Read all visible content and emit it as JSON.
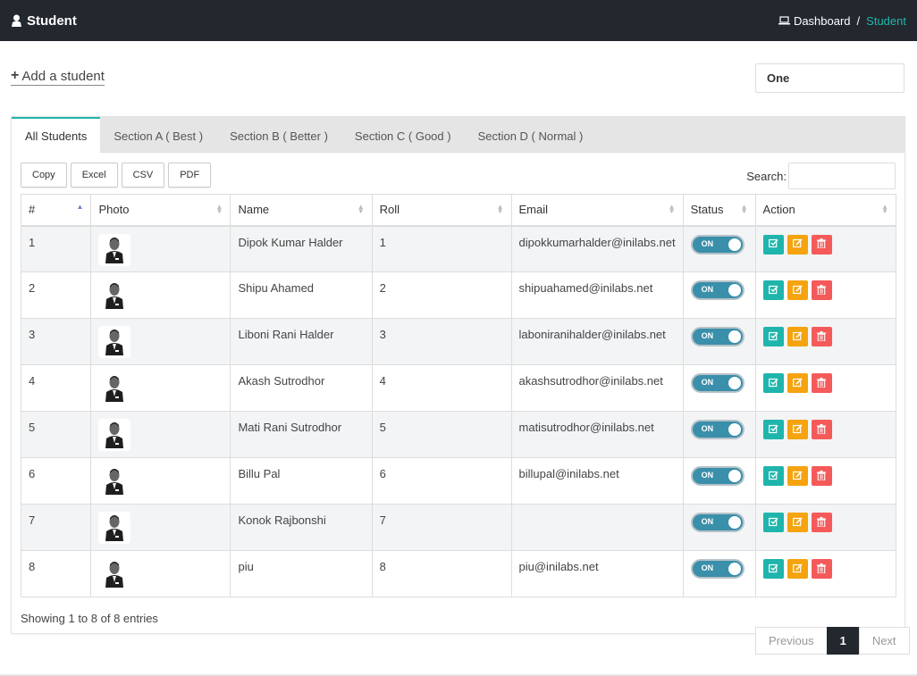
{
  "header": {
    "title": "Student",
    "breadcrumb_home": "Dashboard",
    "breadcrumb_sep": "/",
    "breadcrumb_current": "Student"
  },
  "add_link": {
    "icon": "plus-icon",
    "label": "Add a student"
  },
  "class_select": {
    "value": "One"
  },
  "tabs": [
    {
      "label": "All Students"
    },
    {
      "label": "Section A ( Best )"
    },
    {
      "label": "Section B ( Better )"
    },
    {
      "label": "Section C ( Good )"
    },
    {
      "label": "Section D ( Normal )"
    }
  ],
  "export_buttons": [
    {
      "label": "Copy"
    },
    {
      "label": "Excel"
    },
    {
      "label": "CSV"
    },
    {
      "label": "PDF"
    }
  ],
  "search": {
    "label": "Search:",
    "value": ""
  },
  "table": {
    "columns": [
      "#",
      "Photo",
      "Name",
      "Roll",
      "Email",
      "Status",
      "Action"
    ],
    "rows": [
      {
        "num": "1",
        "name": "Dipok Kumar Halder",
        "roll": "1",
        "email": "dipokkumarhalder@inilabs.net",
        "status": "ON"
      },
      {
        "num": "2",
        "name": "Shipu Ahamed",
        "roll": "2",
        "email": "shipuahamed@inilabs.net",
        "status": "ON"
      },
      {
        "num": "3",
        "name": "Liboni Rani Halder",
        "roll": "3",
        "email": "laboniranihalder@inilabs.net",
        "status": "ON"
      },
      {
        "num": "4",
        "name": "Akash Sutrodhor",
        "roll": "4",
        "email": "akashsutrodhor@inilabs.net",
        "status": "ON"
      },
      {
        "num": "5",
        "name": "Mati Rani Sutrodhor",
        "roll": "5",
        "email": "matisutrodhor@inilabs.net",
        "status": "ON"
      },
      {
        "num": "6",
        "name": "Billu Pal",
        "roll": "6",
        "email": "billupal@inilabs.net",
        "status": "ON"
      },
      {
        "num": "7",
        "name": "Konok Rajbonshi",
        "roll": "7",
        "email": "",
        "status": "ON"
      },
      {
        "num": "8",
        "name": "piu",
        "roll": "8",
        "email": "piu@inilabs.net",
        "status": "ON"
      }
    ]
  },
  "info": "Showing 1 to 8 of 8 entries",
  "pagination": {
    "previous": "Previous",
    "current": "1",
    "next": "Next"
  },
  "colors": {
    "topbar": "#23282f",
    "accent": "#1fb5ac",
    "view": "#1fb5ac",
    "edit": "#f5a30f",
    "delete": "#f55a5a",
    "toggle": "#3a8faa"
  }
}
